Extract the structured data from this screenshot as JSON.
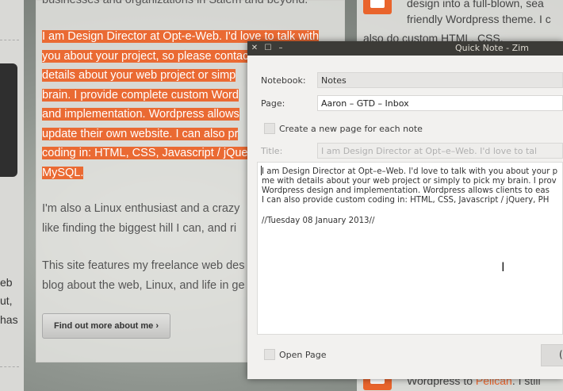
{
  "website": {
    "top_cut_text": "businesses and organizations in Salem and beyond.",
    "highlighted_paragraph": "I am Design Director at Opt-e-Web. I'd love to talk with\nyou about your project, so please contact me\ndetails about your web project or simp\nbrain. I provide complete custom Word\nand implementation. Wordpress allows\nupdate their own website. I can also pr\ncoding in: HTML, CSS, Javascript / jQue\nMySQL.",
    "paragraph2": "I'm also a Linux enthusiast and a crazy\nlike finding the biggest hill I can, and ri",
    "paragraph3": "This site features my freelance web des\nblog about the web, Linux, and life in ge",
    "find_out_more_button": "Find out more about me ›",
    "left_column_text": [
      "eb",
      "ut,",
      "has"
    ],
    "right_column": {
      "line1": "design into a full-blown, sea",
      "line2": "friendly Wordpress theme. I c",
      "line3": "also do custom HTML, CSS,",
      "bottom_line_prefix": "Wordpress to ",
      "bottom_link": "Pelican",
      "bottom_line_suffix": ". I still"
    }
  },
  "dialog": {
    "title": "Quick Note - Zim",
    "titlebar_buttons": [
      "✕",
      "☐",
      "–"
    ],
    "notebook_label": "Notebook:",
    "notebook_value": "Notes",
    "page_label": "Page:",
    "page_value": "Aaron – GTD – Inbox",
    "create_new_page_label": "Create a new page for each note",
    "title_label": "Title:",
    "title_value": "I am Design Director at Opt–e–Web. I'd love to tal",
    "note_lines": [
      "I am Design Director at Opt–e–Web. I'd love to talk with you about your p",
      "me with details about your web project or simply to pick my brain. I prov",
      "Wordpress design and implementation. Wordpress allows clients to eas",
      "I can also provide custom coding in: HTML, CSS, Javascript / jQuery, PH"
    ],
    "note_date": "//Tuesday 08 January 2013//",
    "open_page_label": "Open Page",
    "ok_button_fragment": "("
  },
  "colors": {
    "accent": "#ea6a33",
    "titlebar": "#3c3b37"
  },
  "icons": [
    "close-icon",
    "maximize-icon",
    "minimize-icon",
    "text-cursor-icon"
  ]
}
